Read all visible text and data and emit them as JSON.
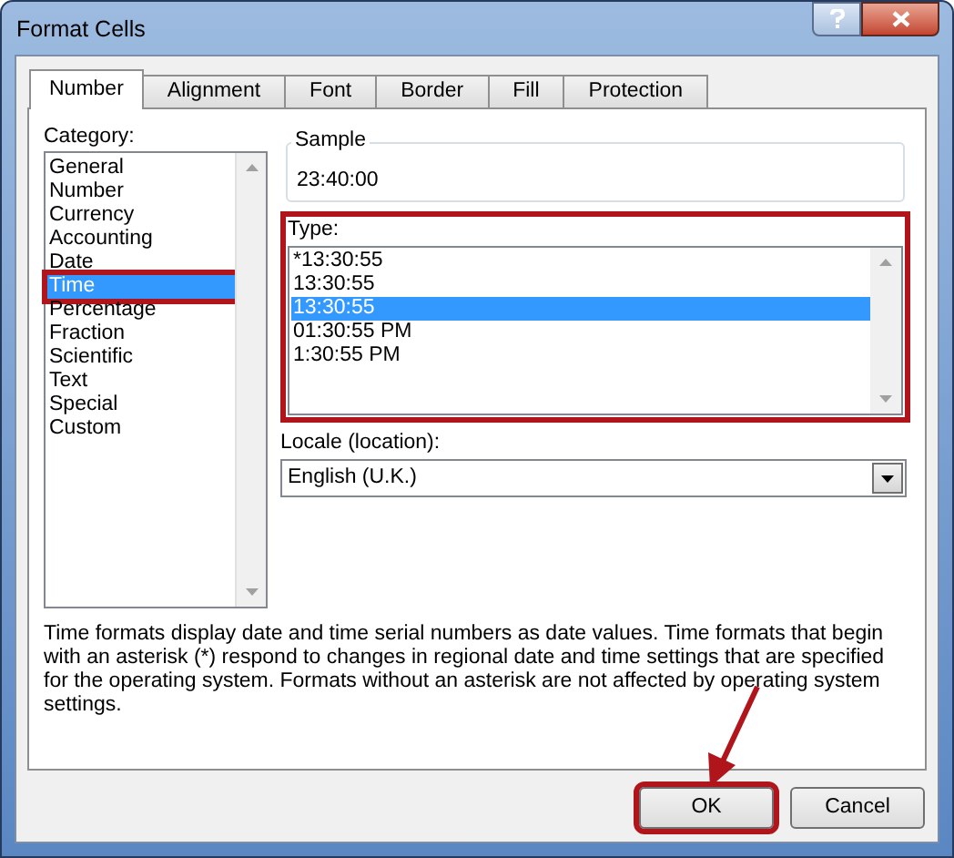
{
  "window": {
    "title": "Format Cells"
  },
  "tabs": [
    {
      "label": "Number",
      "selected": true
    },
    {
      "label": "Alignment",
      "selected": false
    },
    {
      "label": "Font",
      "selected": false
    },
    {
      "label": "Border",
      "selected": false
    },
    {
      "label": "Fill",
      "selected": false
    },
    {
      "label": "Protection",
      "selected": false
    }
  ],
  "category": {
    "label": "Category:",
    "items": [
      {
        "label": "General",
        "selected": false
      },
      {
        "label": "Number",
        "selected": false
      },
      {
        "label": "Currency",
        "selected": false
      },
      {
        "label": "Accounting",
        "selected": false
      },
      {
        "label": "Date",
        "selected": false
      },
      {
        "label": "Time",
        "selected": true
      },
      {
        "label": "Percentage",
        "selected": false
      },
      {
        "label": "Fraction",
        "selected": false
      },
      {
        "label": "Scientific",
        "selected": false
      },
      {
        "label": "Text",
        "selected": false
      },
      {
        "label": "Special",
        "selected": false
      },
      {
        "label": "Custom",
        "selected": false
      }
    ]
  },
  "sample": {
    "label": "Sample",
    "value": "23:40:00"
  },
  "type": {
    "label": "Type:",
    "items": [
      {
        "label": "*13:30:55",
        "selected": false
      },
      {
        "label": "13:30:55",
        "selected": false
      },
      {
        "label": "13:30:55",
        "selected": true
      },
      {
        "label": "01:30:55 PM",
        "selected": false
      },
      {
        "label": "1:30:55 PM",
        "selected": false
      }
    ]
  },
  "locale": {
    "label": "Locale (location):",
    "value": "English (U.K.)"
  },
  "description": "Time formats display date and time serial numbers as date values.  Time formats that begin with an asterisk (*) respond to changes in regional date and time settings that are specified for the operating system. Formats without an asterisk are not affected by operating system settings.",
  "buttons": [
    {
      "label": "OK",
      "kind": "default"
    },
    {
      "label": "Cancel",
      "kind": "normal"
    }
  ]
}
